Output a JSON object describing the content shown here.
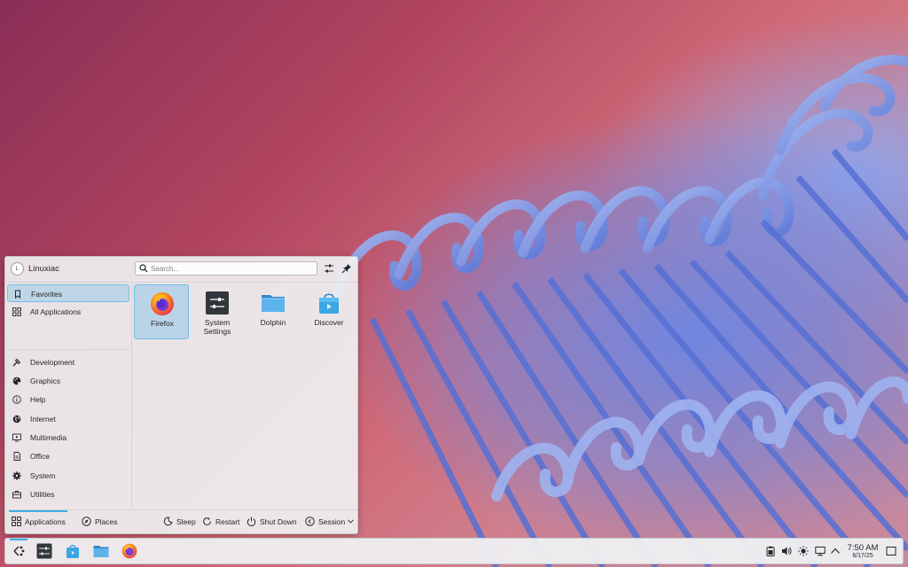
{
  "colors": {
    "accent": "#3daee9",
    "panel": "#eff0f1"
  },
  "launcher": {
    "username": "Linuxiac",
    "avatar_letter": "L",
    "search_placeholder": "Search...",
    "header_icons": [
      "configure-icon",
      "pin-icon"
    ],
    "sidebar": [
      {
        "label": "Favorites",
        "icon": "bookmark-icon",
        "active": true
      },
      {
        "label": "All Applications",
        "icon": "grid-icon"
      },
      {
        "label": "Development",
        "icon": "hammer-icon"
      },
      {
        "label": "Graphics",
        "icon": "palette-icon"
      },
      {
        "label": "Help",
        "icon": "info-icon"
      },
      {
        "label": "Internet",
        "icon": "globe-icon"
      },
      {
        "label": "Multimedia",
        "icon": "media-icon"
      },
      {
        "label": "Office",
        "icon": "document-icon"
      },
      {
        "label": "System",
        "icon": "gear-icon"
      },
      {
        "label": "Utilities",
        "icon": "toolbox-icon"
      }
    ],
    "favorites": [
      {
        "name": "Firefox",
        "icon": "firefox-icon",
        "active": true
      },
      {
        "name": "System\nSettings",
        "icon": "system-settings-icon"
      },
      {
        "name": "Dolphin",
        "icon": "dolphin-folder-icon"
      },
      {
        "name": "Discover",
        "icon": "discover-bag-icon"
      }
    ],
    "footer": {
      "tabs": [
        {
          "label": "Applications",
          "icon": "grid-icon",
          "active": true
        },
        {
          "label": "Places",
          "icon": "compass-icon"
        }
      ],
      "power": [
        {
          "label": "Sleep",
          "icon": "sleep-icon"
        },
        {
          "label": "Restart",
          "icon": "restart-icon"
        },
        {
          "label": "Shut Down",
          "icon": "power-icon"
        },
        {
          "label": "Session",
          "icon": "session-icon"
        }
      ]
    }
  },
  "taskbar": {
    "tasks": [
      "application-launcher-icon",
      "system-settings-icon",
      "discover-bag-icon",
      "dolphin-folder-icon",
      "firefox-icon"
    ],
    "tray": [
      "clipboard-icon",
      "volume-icon",
      "brightness-icon",
      "network-icon",
      "chevron-up-icon"
    ],
    "clock": {
      "time": "7:50 AM",
      "date": "6/17/25"
    },
    "show_desktop_icon": "show-desktop-icon"
  }
}
